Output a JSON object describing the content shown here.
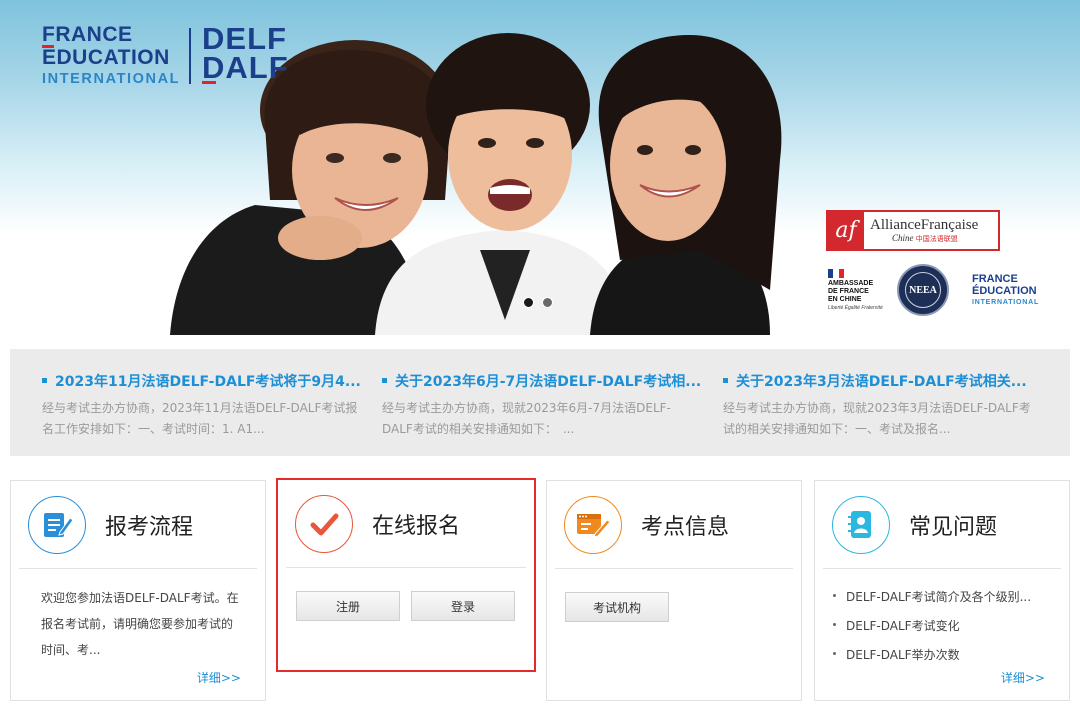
{
  "banner": {
    "logo_fe": {
      "line1": "FRANCE",
      "line2": "ÉDUCATION",
      "line3": "INTERNATIONAL"
    },
    "logo_delf": {
      "line1": "DELF",
      "line2": "DALF"
    },
    "carousel": {
      "slides": 2,
      "active": 1
    },
    "partners": {
      "af_mark": "af",
      "af_name": "AllianceFrançaise",
      "af_sub": "Chine",
      "af_sub_cn": "中国法语联盟",
      "ambassade": [
        "AMBASSADE",
        "DE FRANCE",
        "EN CHINE"
      ],
      "ambassade_motto": "Liberté Égalité Fraternité",
      "neea": "NEEA",
      "fe_small": {
        "line1": "FRANCE",
        "line2": "ÉDUCATION",
        "line3": "INTERNATIONAL"
      }
    },
    "colors": {
      "navy": "#1c3f8c",
      "red": "#e1242a",
      "blue": "#2b86c8"
    }
  },
  "news": [
    {
      "title": "2023年11月法语DELF-DALF考试将于9月4...",
      "desc": "经与考试主办方协商，2023年11月法语DELF-DALF考试报名工作安排如下：一、考试时间：1. A1..."
    },
    {
      "title": "关于2023年6月-7月法语DELF-DALF考试相...",
      "desc": "经与考试主办方协商，现就2023年6月-7月法语DELF-DALF考试的相关安排通知如下：　..."
    },
    {
      "title": "关于2023年3月法语DELF-DALF考试相关...",
      "desc": "经与考试主办方协商，现就2023年3月法语DELF-DALF考试的相关安排通知如下：一、考试及报名..."
    }
  ],
  "cards": {
    "process": {
      "title": "报考流程",
      "body": "欢迎您参加法语DELF-DALF考试。在报名考试前，请明确您要参加考试的时间、考...",
      "more": "详细>>",
      "icon": "document-edit-icon"
    },
    "register": {
      "title": "在线报名",
      "btn_signup": "注册",
      "btn_login": "登录",
      "icon": "checkmark-icon"
    },
    "center": {
      "title": "考点信息",
      "btn_institutions": "考试机构",
      "icon": "window-edit-icon"
    },
    "faq": {
      "title": "常见问题",
      "items": [
        "DELF-DALF考试简介及各个级别...",
        "DELF-DALF考试变化",
        "DELF-DALF举办次数"
      ],
      "more": "详细>>",
      "icon": "contact-book-icon"
    }
  },
  "accent": {
    "link": "#1d8fd6",
    "highlight": "#e32b2b",
    "orange": "#f08a1e"
  }
}
